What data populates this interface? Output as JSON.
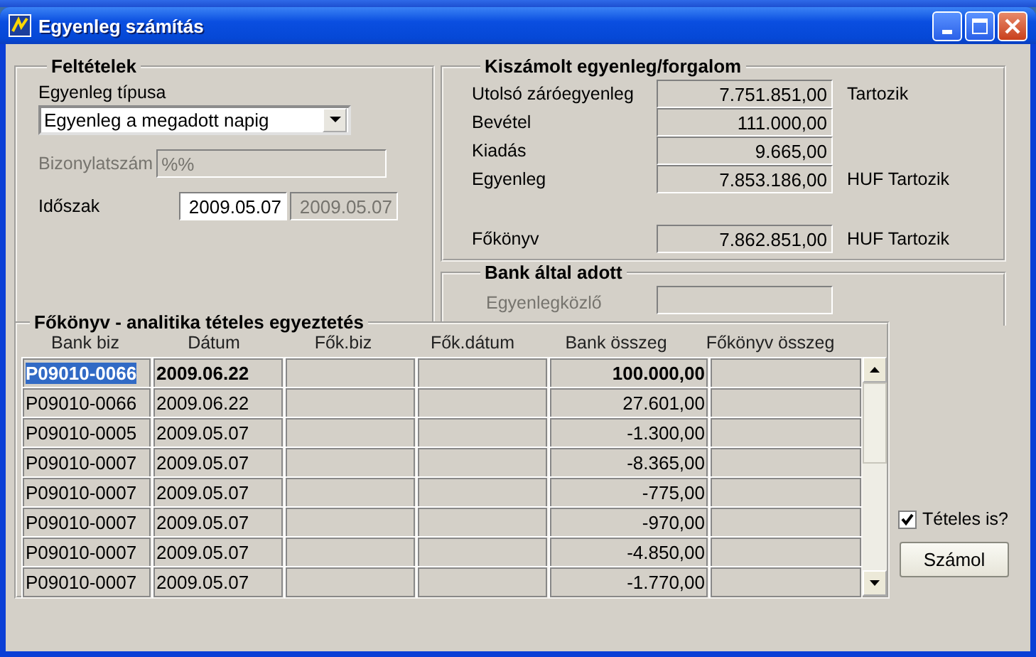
{
  "window": {
    "title": "Egyenleg számítás"
  },
  "conditions": {
    "legend": "Feltételek",
    "balance_type": {
      "label": "Egyenleg típusa",
      "value": "Egyenleg a megadott napig"
    },
    "document_number": {
      "label": "Bizonylatszám",
      "value": "%%",
      "disabled": true
    },
    "period": {
      "label": "Időszak",
      "from": {
        "value": "2009.05.07",
        "disabled": false
      },
      "to": {
        "value": "2009.05.07",
        "disabled": true
      }
    }
  },
  "computed": {
    "legend": "Kiszámolt egyenleg/forgalom",
    "rows": [
      {
        "label": "Utolsó záróegyenleg",
        "value": "7.751.851,00",
        "suffix": "Tartozik"
      },
      {
        "label": "Bevétel",
        "value": "111.000,00"
      },
      {
        "label": "Kiadás",
        "value": "9.665,00"
      },
      {
        "label": "Egyenleg",
        "value": "7.853.186,00",
        "suffix": "HUF Tartozik"
      }
    ],
    "ledger": {
      "label": "Főkönyv",
      "value": "7.862.851,00",
      "suffix": "HUF Tartozik"
    }
  },
  "bank": {
    "legend": "Bank által adott",
    "statement": {
      "label": "Egyenlegközlő",
      "disabled": true
    }
  },
  "reconciliation": {
    "legend": "Főkönyv - analitika tételes egyeztetés",
    "columns": [
      "Bank biz",
      "Dátum",
      "Fők.biz",
      "Fők.dátum",
      "Bank összeg",
      "Főkönyv összeg"
    ],
    "rows": [
      {
        "selected": true,
        "cells": [
          "P09010-0066",
          "2009.06.22",
          "",
          "",
          "100.000,00",
          ""
        ]
      },
      {
        "selected": false,
        "cells": [
          "P09010-0066",
          "2009.06.22",
          "",
          "",
          "27.601,00",
          ""
        ]
      },
      {
        "selected": false,
        "cells": [
          "P09010-0005",
          "2009.05.07",
          "",
          "",
          "-1.300,00",
          ""
        ]
      },
      {
        "selected": false,
        "cells": [
          "P09010-0007",
          "2009.05.07",
          "",
          "",
          "-8.365,00",
          ""
        ]
      },
      {
        "selected": false,
        "cells": [
          "P09010-0007",
          "2009.05.07",
          "",
          "",
          "-775,00",
          ""
        ]
      },
      {
        "selected": false,
        "cells": [
          "P09010-0007",
          "2009.05.07",
          "",
          "",
          "-970,00",
          ""
        ]
      },
      {
        "selected": false,
        "cells": [
          "P09010-0007",
          "2009.05.07",
          "",
          "",
          "-4.850,00",
          ""
        ]
      },
      {
        "selected": false,
        "cells": [
          "P09010-0007",
          "2009.05.07",
          "",
          "",
          "-1.770,00",
          ""
        ]
      }
    ]
  },
  "itemized": {
    "label": "Tételes is?",
    "checked": true
  },
  "calculate_button": {
    "label": "Számol"
  }
}
